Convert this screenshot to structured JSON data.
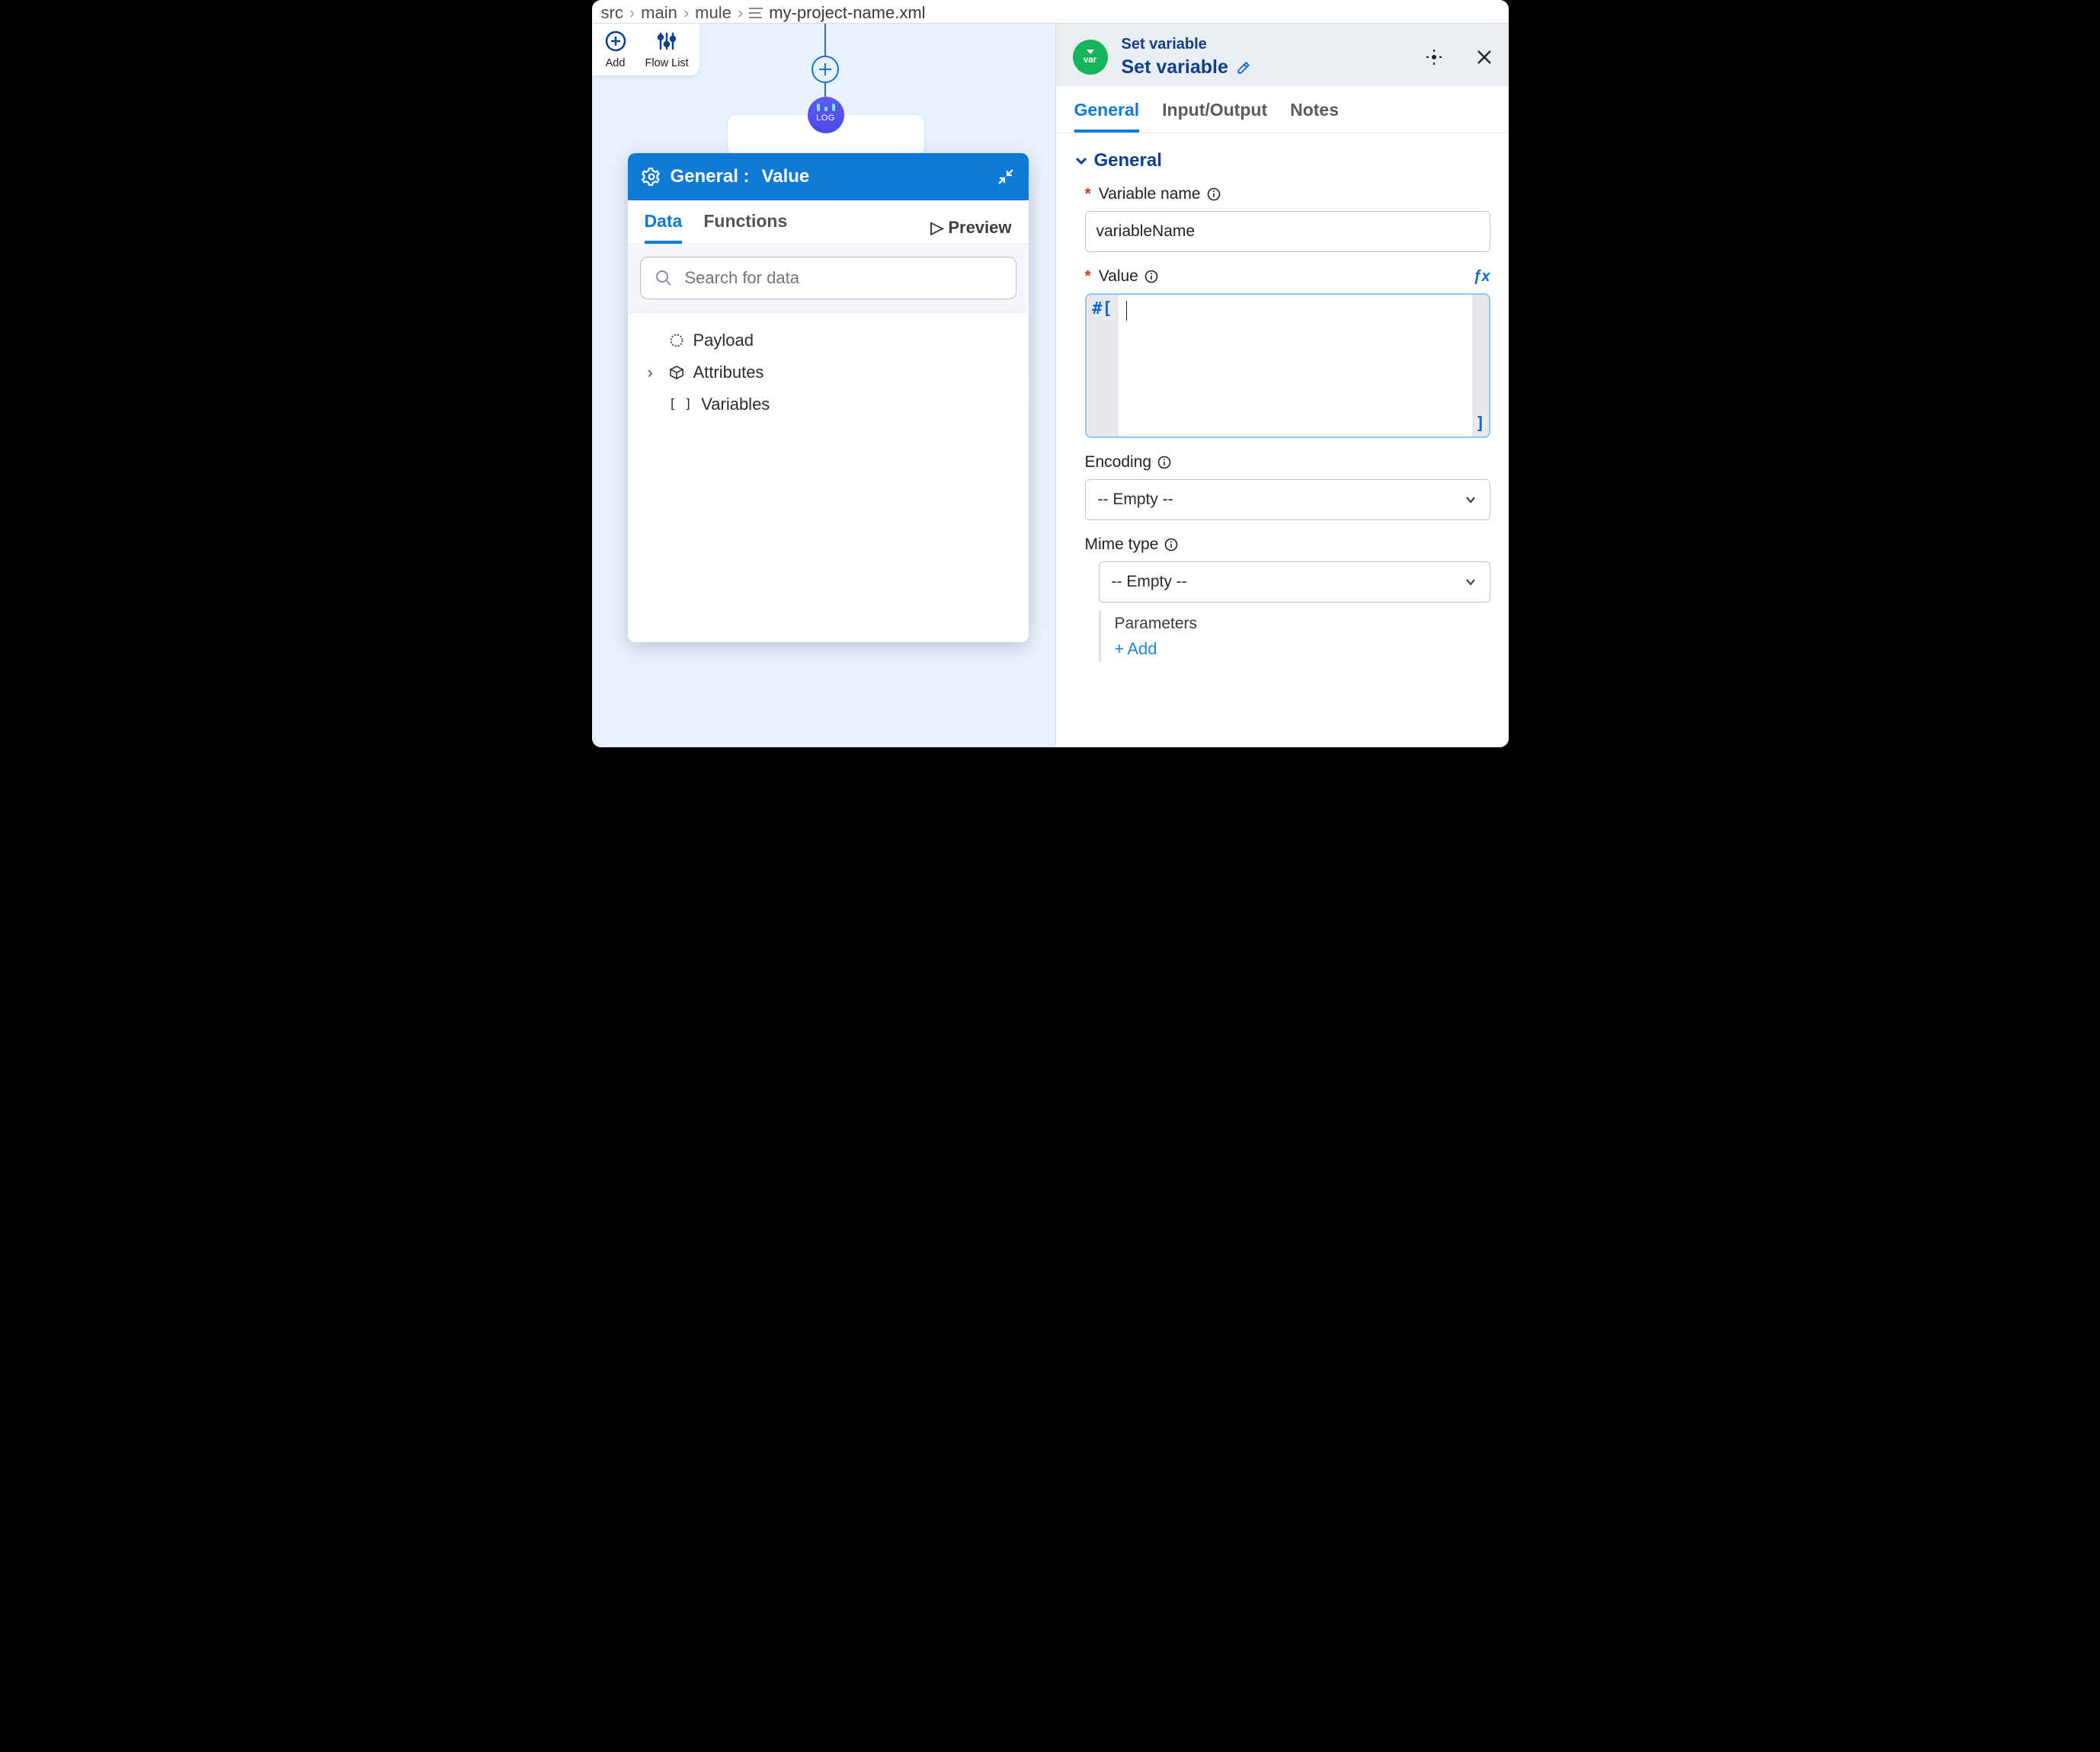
{
  "breadcrumbs": {
    "p0": "src",
    "p1": "main",
    "p2": "mule",
    "file": "my-project-name.xml"
  },
  "toolbar": {
    "add": "Add",
    "flow_list": "Flow List"
  },
  "canvas": {
    "log_label": "LOG"
  },
  "popover": {
    "title_prefix": "General :",
    "title_field": "Value",
    "tabs": {
      "data": "Data",
      "functions": "Functions"
    },
    "preview": "Preview",
    "search_placeholder": "Search for data",
    "tree": {
      "payload": "Payload",
      "attributes": "Attributes",
      "variables": "Variables"
    }
  },
  "panel": {
    "super_title": "Set variable",
    "title": "Set variable",
    "badge_text": "var",
    "tabs": {
      "general": "General",
      "io": "Input/Output",
      "notes": "Notes"
    },
    "section": "General",
    "variable_name_label": "Variable name",
    "variable_name_value": "variableName",
    "value_label": "Value",
    "value_prefix": "#[",
    "value_suffix": "]",
    "encoding_label": "Encoding",
    "encoding_value": "-- Empty --",
    "mime_label": "Mime type",
    "mime_value": "-- Empty --",
    "parameters_label": "Parameters",
    "add_label": "Add"
  }
}
